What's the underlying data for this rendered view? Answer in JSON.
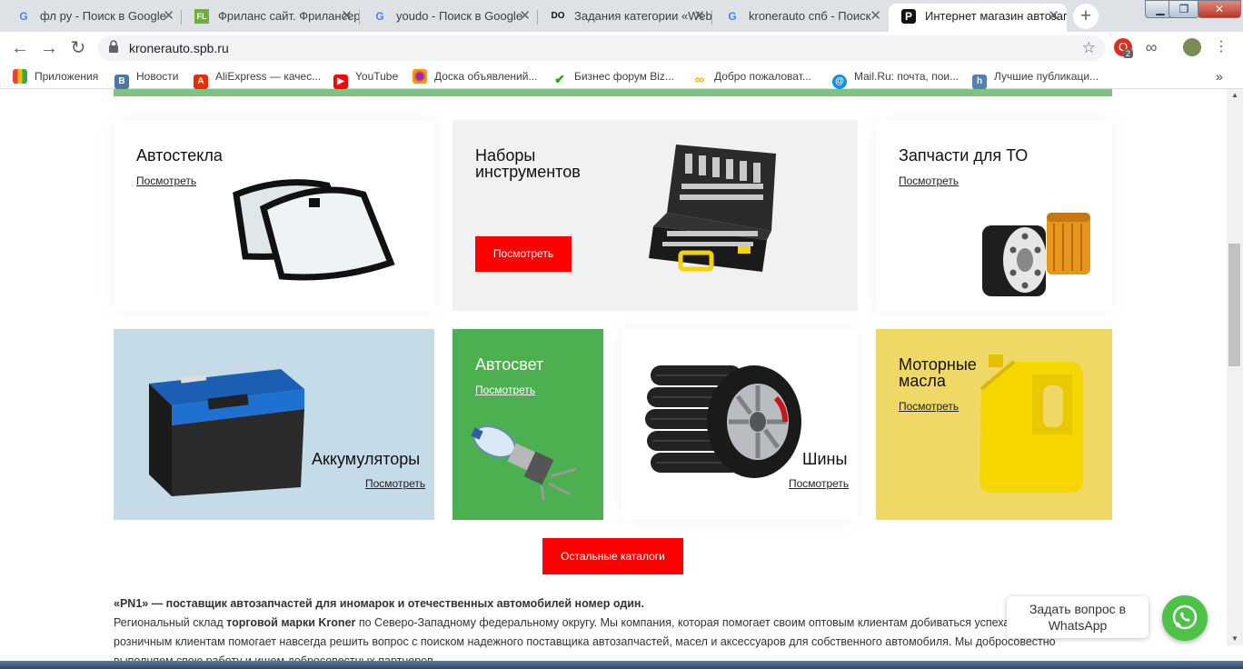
{
  "tabs": [
    {
      "title": "фл ру - Поиск в Google",
      "fav": "G",
      "fav_color": "#4285f4"
    },
    {
      "title": "Фриланс сайт. Фрилансеры",
      "fav": "FL",
      "fav_color": "#6fae3e"
    },
    {
      "title": "youdo - Поиск в Google",
      "fav": "G",
      "fav_color": "#4285f4"
    },
    {
      "title": "Задания категории «Web",
      "fav": "DO",
      "fav_color": "#ff5a1f"
    },
    {
      "title": "kronerauto спб - Поиск",
      "fav": "G",
      "fav_color": "#4285f4"
    },
    {
      "title": "Интернет магазин автозапчастей",
      "fav": "P",
      "fav_color": "#111111"
    }
  ],
  "toolbar": {
    "url": "kronerauto.spb.ru",
    "ext_badge": "2"
  },
  "bookmarks": [
    {
      "label": "Приложения",
      "color": "#e94235"
    },
    {
      "label": "Новости",
      "color": "#4a76a8"
    },
    {
      "label": "AliExpress — качес...",
      "color": "#e62e04"
    },
    {
      "label": "YouTube",
      "color": "#ff0000"
    },
    {
      "label": "Доска объявлений...",
      "color": "#9c27b0"
    },
    {
      "label": "Бизнес форум Biz...",
      "color": "#2ca01c"
    },
    {
      "label": "Добро пожаловат...",
      "color": "#f5b000"
    },
    {
      "label": "Mail.Ru: почта, пои...",
      "color": "#168de2"
    },
    {
      "label": "Лучшие публикаци...",
      "color": "#547fb4"
    }
  ],
  "catalog": {
    "glass": {
      "title": "Автостекла",
      "link": "Посмотреть"
    },
    "tools": {
      "title_1": "Наборы",
      "title_2": "инструментов",
      "button": "Посмотреть"
    },
    "service": {
      "title": "Запчасти для ТО",
      "link": "Посмотреть"
    },
    "battery": {
      "title": "Аккумуляторы",
      "link": "Посмотреть"
    },
    "light": {
      "title": "Автосвет",
      "link": "Посмотреть"
    },
    "tires": {
      "title": "Шины",
      "link": "Посмотреть"
    },
    "oil": {
      "title_1": "Моторные",
      "title_2": "масла",
      "link": "Посмотреть"
    },
    "more_button": "Остальные каталоги"
  },
  "about": {
    "heading": "«PN1» — поставщик автозапчастей для иномарок и отечественных автомобилей номер один.",
    "p_start": "Региональный склад ",
    "p_bold": "торговой марки Kroner",
    "p_rest": " по Северо-Западному федеральному округу. Мы компания, которая помогает своим оптовым клиентам добиваться успеха в бизнесе, а розничным клиентам помогает навсегда решить вопрос с поиском надежного поставщика автозапчастей, масел и аксессуаров для собственного автомобиля. Мы добросовестно выполняем свою работу и ищем добросовестных партнеров."
  },
  "whatsapp": {
    "line1": "Задать вопрос в",
    "line2": "WhatsApp"
  },
  "colors": {
    "accent_red": "#ff0000",
    "green": "#4caf50",
    "battery_bg": "#c5dbe8",
    "oil_bg": "#efd866",
    "tools_bg": "#f0f1f3"
  }
}
